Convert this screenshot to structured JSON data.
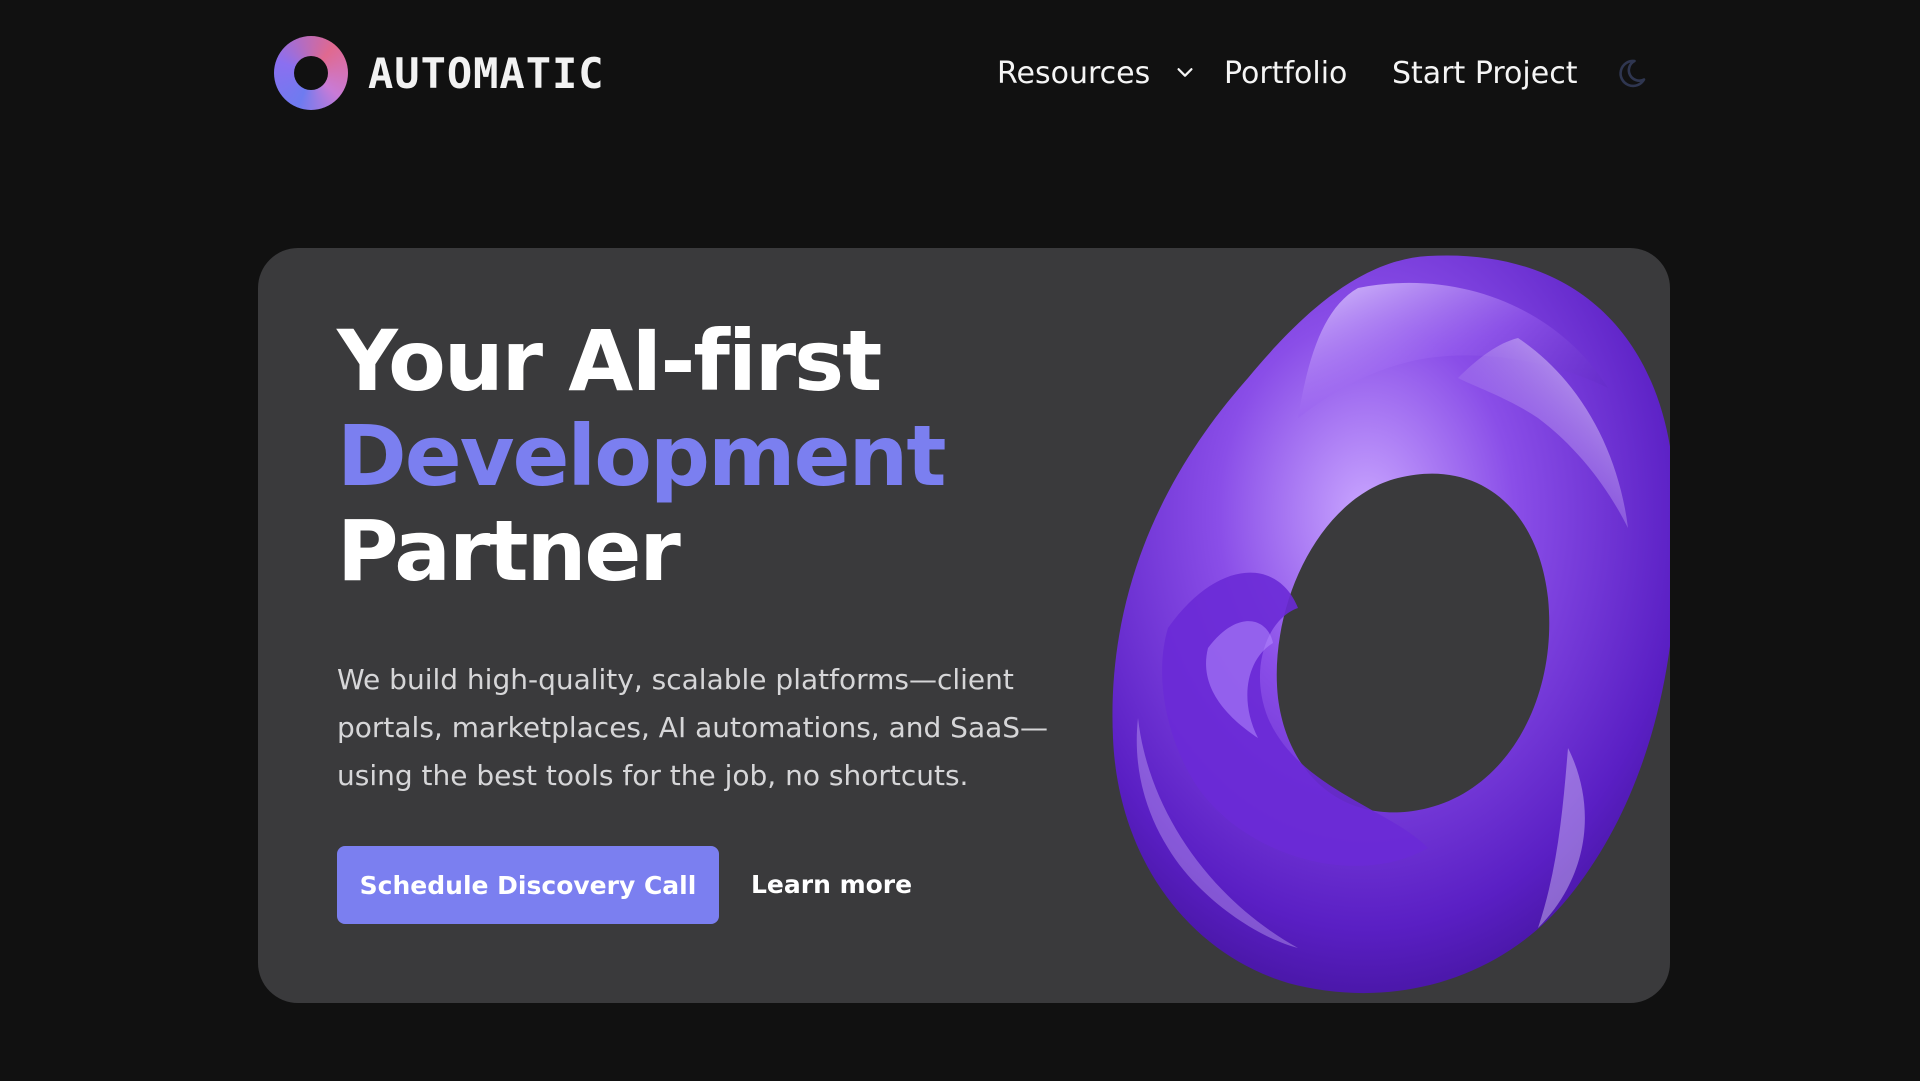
{
  "brand": {
    "name": "AUTOMATIC",
    "logo_icon": "ring-logo",
    "colors": {
      "ring_start": "#6e7bf0",
      "ring_end": "#e0698f"
    }
  },
  "nav": {
    "items": [
      {
        "label": "Resources",
        "has_dropdown": true,
        "icon": "chevron-down-icon"
      },
      {
        "label": "Portfolio"
      },
      {
        "label": "Start Project"
      }
    ],
    "theme_toggle_icon": "moon-icon"
  },
  "hero": {
    "title_line1": "Your AI-first",
    "title_line2": "Development",
    "title_line3": "Partner",
    "description": "We build high-quality, scalable platforms—client portals, marketplaces, AI automations, and SaaS—using the best tools for the job, no shortcuts.",
    "primary_cta": "Schedule Discovery Call",
    "secondary_cta": "Learn more",
    "art": "purple-glass-swirl"
  },
  "colors": {
    "page_background": "#111111",
    "card_background": "#3a3a3c",
    "accent": "#7b7ff0",
    "art_purple": "#7a3de0"
  }
}
